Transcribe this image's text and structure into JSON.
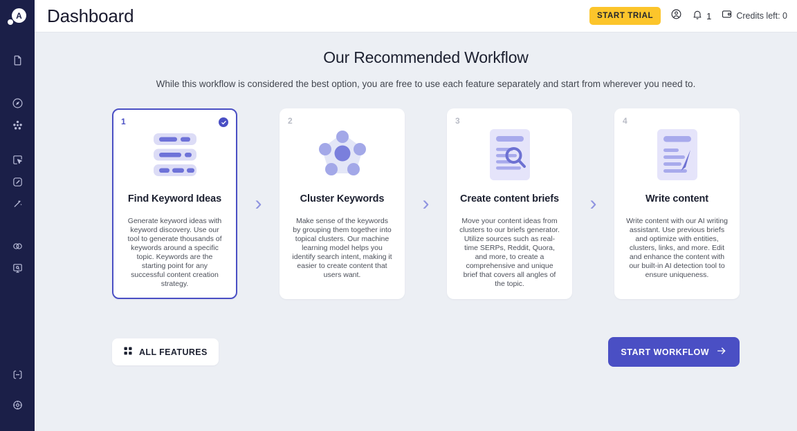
{
  "brand": {
    "logo_letter": "A"
  },
  "sidebar": {
    "items": [
      {
        "icon": "document-icon"
      },
      {
        "icon": "compass-icon"
      },
      {
        "icon": "cluster-nodes-icon"
      },
      {
        "icon": "cursor-click-icon"
      },
      {
        "icon": "edit-square-icon"
      },
      {
        "icon": "magic-wand-icon"
      },
      {
        "icon": "venn-diagram-icon"
      },
      {
        "icon": "monitor-search-icon"
      },
      {
        "icon": "minus-circle-icon"
      },
      {
        "icon": "target-settings-icon"
      }
    ]
  },
  "header": {
    "title": "Dashboard",
    "trial_label": "START TRIAL",
    "account_icon": "user-circle-icon",
    "bell_icon": "bell-icon",
    "notification_count": "1",
    "wallet_icon": "wallet-icon",
    "credits_text": "Credits left: 0",
    "fullscreen_icon": "fullscreen-icon",
    "accent_yellow": "#fcc52b"
  },
  "content": {
    "headline": "Our Recommended Workflow",
    "subhead": "While this workflow is considered the best option, you are free to use each feature separately and start from wherever you need to.",
    "chevron": "›",
    "accent_purple": "#4a4fc4",
    "cards": [
      {
        "number": "1",
        "title": "Find Keyword Ideas",
        "description": "Generate keyword ideas with keyword discovery. Use our tool to generate thousands of keywords around a specific topic. Keywords are the starting point for any successful content creation strategy.",
        "illustration": "keyword-list-illustration",
        "selected": true,
        "check_icon": "check-circle-icon"
      },
      {
        "number": "2",
        "title": "Cluster Keywords",
        "description": "Make sense of the keywords by grouping them together into topical clusters. Our machine learning model helps you identify search intent, making it easier to create content that users want.",
        "illustration": "cluster-network-illustration",
        "selected": false
      },
      {
        "number": "3",
        "title": "Create content briefs",
        "description": "Move your content ideas from clusters to our briefs generator. Utilize sources such as real-time SERPs, Reddit, Quora, and more, to create a comprehensive and unique brief that covers all angles of the topic.",
        "illustration": "document-search-illustration",
        "selected": false
      },
      {
        "number": "4",
        "title": "Write content",
        "description": "Write content with our AI writing assistant. Use previous briefs and optimize with entities, clusters, links, and more. Edit and enhance the content with our built-in AI detection tool to ensure uniqueness.",
        "illustration": "document-pen-illustration",
        "selected": false
      }
    ]
  },
  "actions": {
    "all_features_label": "ALL FEATURES",
    "all_features_icon": "grid-icon",
    "start_workflow_label": "START WORKFLOW",
    "start_workflow_icon": "arrow-right-icon"
  }
}
